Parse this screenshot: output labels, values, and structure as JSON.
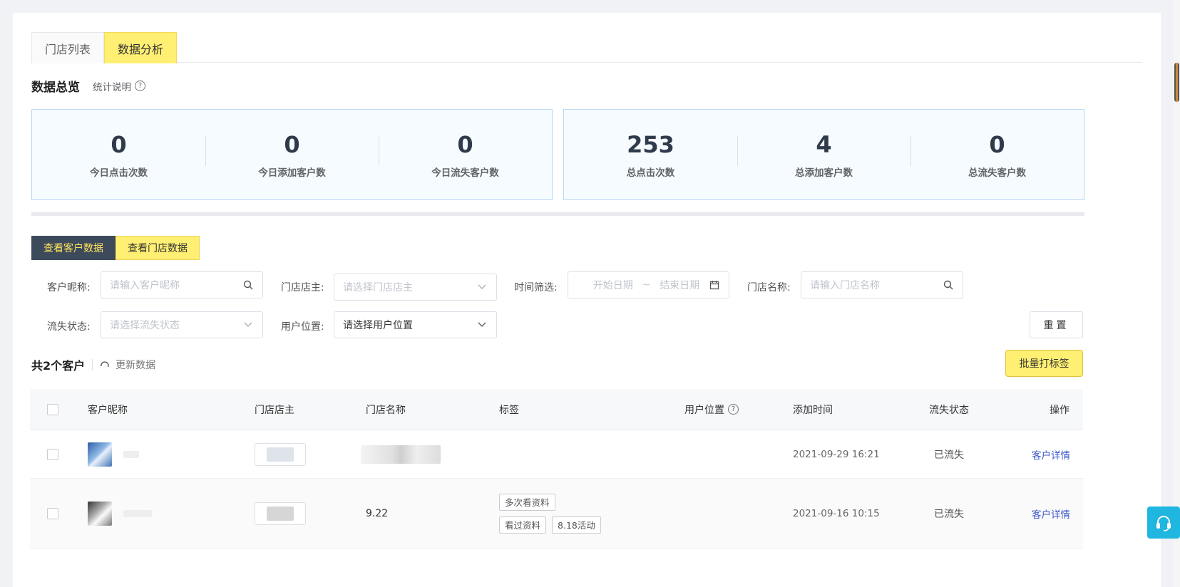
{
  "tabs": [
    {
      "label": "门店列表",
      "active": false
    },
    {
      "label": "数据分析",
      "active": true
    }
  ],
  "overview": {
    "title": "数据总览",
    "explain": "统计说明",
    "today": [
      {
        "value": "0",
        "label": "今日点击次数"
      },
      {
        "value": "0",
        "label": "今日添加客户数"
      },
      {
        "value": "0",
        "label": "今日流失客户数"
      }
    ],
    "total": [
      {
        "value": "253",
        "label": "总点击次数"
      },
      {
        "value": "4",
        "label": "总添加客户数"
      },
      {
        "value": "0",
        "label": "总流失客户数"
      }
    ]
  },
  "view_switch": {
    "customer": "查看客户数据",
    "store": "查看门店数据"
  },
  "filters": {
    "nickname_label": "客户昵称:",
    "nickname_placeholder": "请输入客户昵称",
    "owner_label": "门店店主:",
    "owner_placeholder": "请选择门店店主",
    "time_label": "时间筛选:",
    "start_placeholder": "开始日期",
    "range_sep": "~",
    "end_placeholder": "结束日期",
    "store_name_label": "门店名称:",
    "store_name_placeholder": "请输入门店名称",
    "churn_label": "流失状态:",
    "churn_placeholder": "请选择流失状态",
    "location_label": "用户位置:",
    "location_value": "请选择用户位置",
    "reset": "重置"
  },
  "summary": {
    "count": "共2个客户",
    "refresh": "更新数据",
    "batch_tag": "批量打标签"
  },
  "table": {
    "headers": {
      "nickname": "客户昵称",
      "owner": "门店店主",
      "store": "门店名称",
      "tags": "标签",
      "location": "用户位置",
      "added": "添加时间",
      "status": "流失状态",
      "action": "操作"
    },
    "rows": [
      {
        "store": "",
        "tags": [],
        "added": "2021-09-29 16:21",
        "status": "已流失",
        "action": "客户详情"
      },
      {
        "store": "9.22",
        "tags": [
          [
            "多次看资料"
          ],
          [
            "看过资料",
            "8.18活动"
          ]
        ],
        "added": "2021-09-16 10:15",
        "status": "已流失",
        "action": "客户详情"
      }
    ]
  },
  "colors": {
    "accent_yellow": "#ffef73",
    "dark_button": "#3c4a5c",
    "link_blue": "#3a56c8",
    "stat_border": "#b9d9f5",
    "service_cyan": "#1fb6e0"
  }
}
